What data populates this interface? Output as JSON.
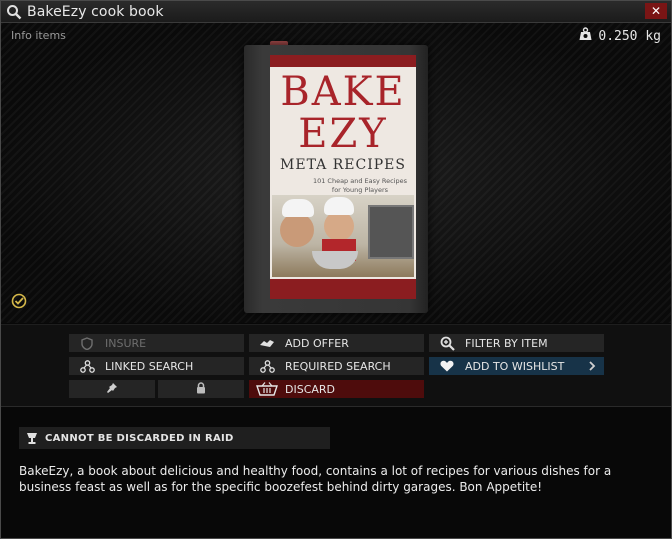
{
  "window": {
    "title": "BakeEzy cook book",
    "close_label": "✕"
  },
  "preview": {
    "info_label": "Info items",
    "weight": "0.250 kg",
    "book": {
      "title_line1": "BAKE",
      "title_line2": "EZY",
      "subtitle": "META RECIPES",
      "tagline": "101 Cheap and Easy Recipes for Young Players"
    }
  },
  "actions": {
    "insure": "INSURE",
    "add_offer": "ADD OFFER",
    "filter_by_item": "FILTER BY ITEM",
    "linked_search": "LINKED SEARCH",
    "required_search": "REQUIRED SEARCH",
    "add_to_wishlist": "ADD TO WISHLIST",
    "discard": "DISCARD"
  },
  "restriction": "CANNOT BE DISCARDED IN RAID",
  "description": "BakeEzy, a book about delicious and healthy food, contains a lot of recipes for various dishes for a business feast as well as for the specific boozefest behind dirty garages. Bon Appetite!",
  "icons": {
    "title": "search-icon",
    "close": "close-icon",
    "weight": "weight-icon",
    "check": "check-icon",
    "insure": "shield-icon",
    "add_offer": "handshake-icon",
    "filter": "zoom-icon",
    "linked": "nodes-icon",
    "required": "nodes-icon",
    "wishlist": "heart-icon",
    "pin": "pin-icon",
    "lock": "lock-icon",
    "discard": "basket-icon",
    "restriction": "goblet-icon"
  },
  "colors": {
    "close": "#7a1515",
    "wishlist": "#173348",
    "discard": "#4e0c0c",
    "check": "#d6b94a"
  }
}
